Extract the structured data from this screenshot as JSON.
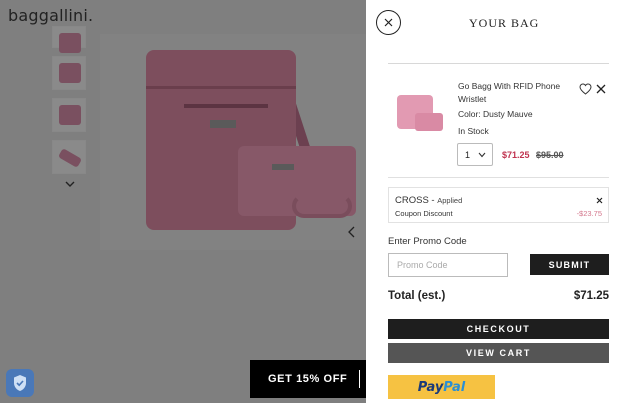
{
  "store": {
    "logo": "baggallini."
  },
  "promo_banner": {
    "text": "GET 15% OFF"
  },
  "drawer": {
    "title": "YOUR BAG",
    "item": {
      "name": "Go Bagg With RFID Phone Wristlet",
      "color": "Color: Dusty Mauve",
      "stock": "In Stock",
      "quantity": "1",
      "sale_price": "$71.25",
      "original_price": "$95.00"
    },
    "coupon": {
      "code": "CROSS - ",
      "status": "Applied",
      "label": "Coupon Discount",
      "amount": "-$23.75"
    },
    "promo": {
      "label": "Enter Promo Code",
      "placeholder": "Promo Code",
      "submit_label": "SUBMIT"
    },
    "total": {
      "label": "Total (est.)",
      "value": "$71.25"
    },
    "checkout_label": "CHECKOUT",
    "view_cart_label": "VIEW CART",
    "paypal": {
      "part1": "Pay",
      "part2": "Pal"
    }
  },
  "colors": {
    "accent_dark": "#1e1e1e",
    "sale_red": "#c0334f",
    "discount_pink": "#d4788d",
    "paypal_yellow": "#f6c242"
  }
}
